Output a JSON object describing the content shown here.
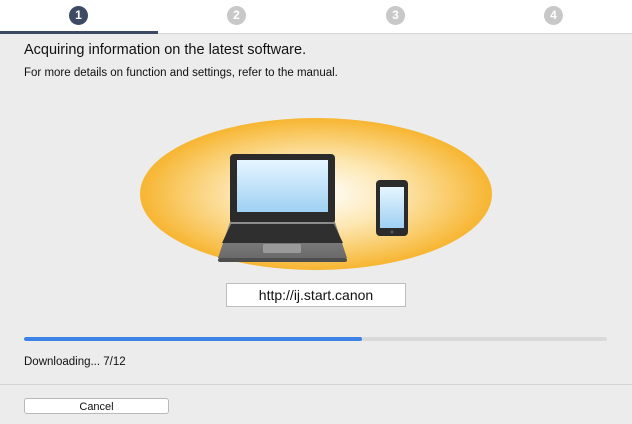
{
  "steps": [
    {
      "number": "1",
      "active": true
    },
    {
      "number": "2",
      "active": false
    },
    {
      "number": "3",
      "active": false
    },
    {
      "number": "4",
      "active": false
    }
  ],
  "main": {
    "heading": "Acquiring information on the latest software.",
    "subheading": "For more details on function and settings, refer to the manual.",
    "url": "http://ij.start.canon"
  },
  "progress": {
    "fraction": 0.58,
    "status": "Downloading... 7/12"
  },
  "footer": {
    "cancel_label": "Cancel"
  },
  "colors": {
    "accent": "#3d4a63",
    "progress": "#3d82e6",
    "glow": "#f7b531"
  },
  "icons": [
    "laptop-icon",
    "smartphone-icon"
  ]
}
